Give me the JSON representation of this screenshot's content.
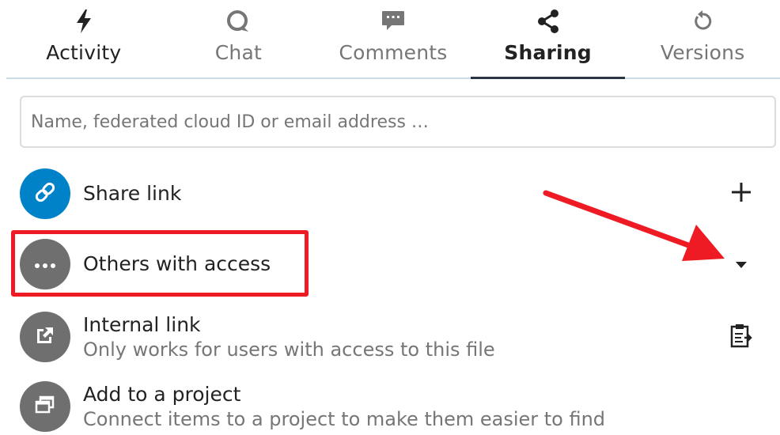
{
  "tabs": [
    {
      "label": "Activity",
      "icon": "lightning-icon"
    },
    {
      "label": "Chat",
      "icon": "chat-bubble-icon"
    },
    {
      "label": "Comments",
      "icon": "comment-icon"
    },
    {
      "label": "Sharing",
      "icon": "share-icon",
      "active": true
    },
    {
      "label": "Versions",
      "icon": "history-icon"
    }
  ],
  "search": {
    "value": "",
    "placeholder": "Name, federated cloud ID or email address …"
  },
  "share_link": {
    "title": "Share link",
    "icon": "link-icon",
    "action_icon": "plus-icon",
    "color": "#0082c9"
  },
  "others_with_access": {
    "title": "Others with access",
    "icon": "more-dots-icon",
    "action_icon": "caret-down-icon"
  },
  "internal_link": {
    "title": "Internal link",
    "subtitle": "Only works for users with access to this file",
    "icon": "external-link-icon",
    "action_icon": "clipboard-icon"
  },
  "add_to_project": {
    "title": "Add to a project",
    "subtitle": "Connect items to a project to make them easier to find",
    "icon": "project-windows-icon"
  },
  "colors": {
    "accent": "#0082c9",
    "annotation": "#ee1b24",
    "tab_underline": "#c9dbe5",
    "muted_text": "#767676"
  }
}
